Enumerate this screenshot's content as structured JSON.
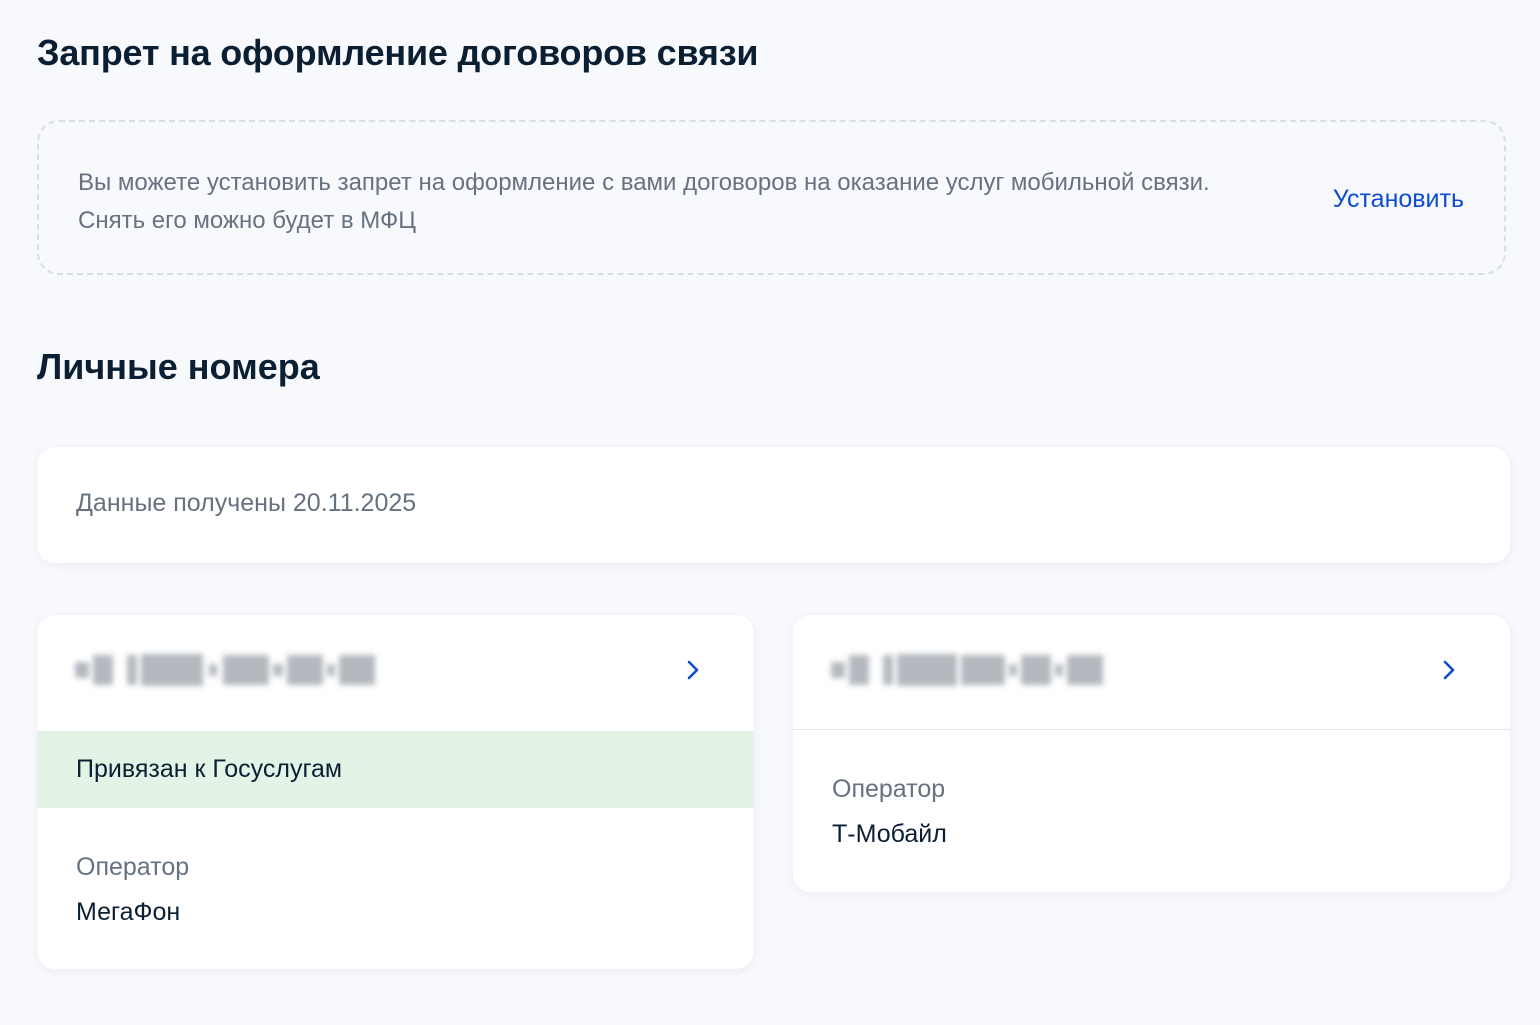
{
  "ban": {
    "title": "Запрет на оформление договоров связи",
    "text_line1": "Вы можете установить запрет на оформление с вами договоров на оказание услуг мобильной связи.",
    "text_line2": "Снять его можно будет в МФЦ",
    "action": "Установить"
  },
  "numbers": {
    "title": "Личные номера",
    "data_received": "Данные получены 20.11.2025",
    "cards": [
      {
        "linked_label": "Привязан к Госуслугам",
        "operator_label": "Оператор",
        "operator_value": "МегаФон"
      },
      {
        "operator_label": "Оператор",
        "operator_value": "Т-Мобайл"
      }
    ]
  },
  "icons": {
    "chevron": "chevron-right-icon"
  },
  "colors": {
    "background": "#f8f9fd",
    "link": "#0d4cd3",
    "linked_bg": "#e3f4e7",
    "text_main": "#0b1f33",
    "text_secondary": "#66727f"
  }
}
